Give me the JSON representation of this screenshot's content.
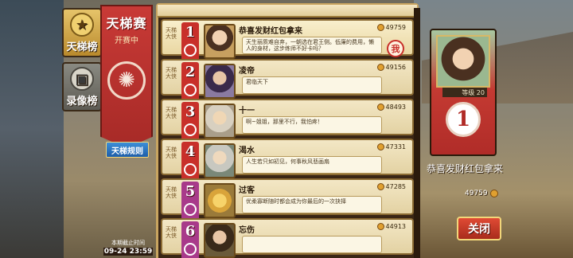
{
  "tabs": [
    {
      "label": "天梯榜",
      "icon": "star-medal-icon",
      "active": true
    },
    {
      "label": "录像榜",
      "icon": "video-tape-icon",
      "active": false
    }
  ],
  "banner": {
    "title": "天梯赛",
    "subtitle": "开赛中"
  },
  "rules_button": "天梯规则",
  "deadline": {
    "label": "本期截止时间",
    "value": "09-24 23:59"
  },
  "ranking": [
    {
      "rank": "1",
      "tier": "天梯大侠",
      "name": "恭喜发财红包拿来",
      "power": "49759",
      "quote": "天生丽质难自弃，一朝选在君王侧。低廉的费用，懒人的身材，这步练师不好卡吗？",
      "me": true,
      "badge_color": "#c8302a"
    },
    {
      "rank": "2",
      "tier": "天梯大侠",
      "name": "凌帝",
      "power": "49156",
      "quote": "君临天下",
      "me": false,
      "badge_color": "#c8302a"
    },
    {
      "rank": "3",
      "tier": "天梯大侠",
      "name": "十一",
      "power": "48493",
      "quote": "啊~姐姐，那里不行，我怕疼！",
      "me": false,
      "badge_color": "#c8302a"
    },
    {
      "rank": "4",
      "tier": "天梯大侠",
      "name": "渴水",
      "power": "47331",
      "quote": "人生若只如初见，何事秋风悲画扇",
      "me": false,
      "badge_color": "#c8302a"
    },
    {
      "rank": "5",
      "tier": "天梯大侠",
      "name": "过客",
      "power": "47285",
      "quote": "优柔寡断随时都会成为你最后的一次抉择",
      "me": false,
      "badge_color": "#a83a8a"
    },
    {
      "rank": "6",
      "tier": "天梯大侠",
      "name": "忘伤",
      "power": "44913",
      "quote": "",
      "me": false,
      "badge_color": "#a83a8a"
    }
  ],
  "me_stamp": "我",
  "my_card": {
    "level": "等级 20",
    "rank": "1",
    "name": "恭喜发财红包拿来",
    "power": "49759"
  },
  "close_button": "关闭"
}
